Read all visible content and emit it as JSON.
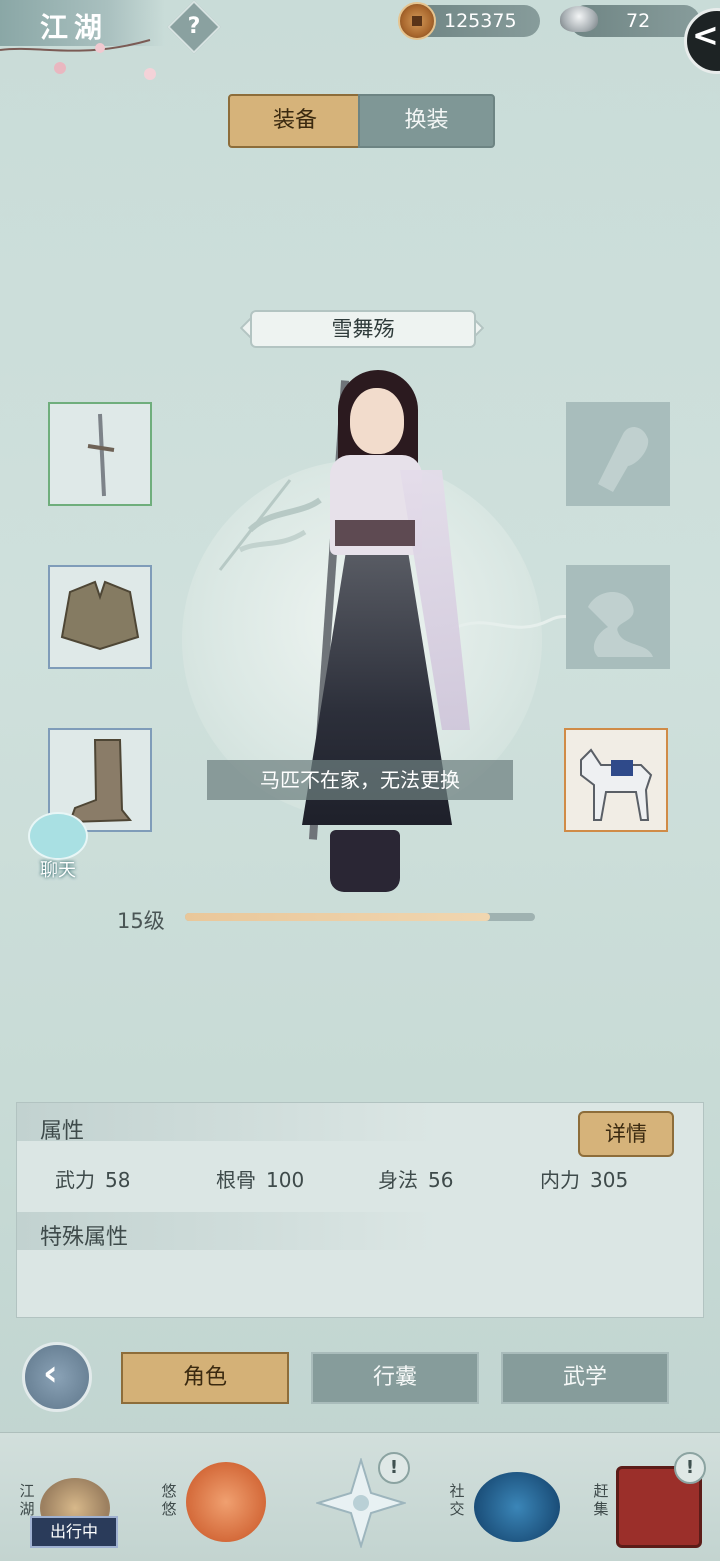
{
  "topbar": {
    "title": "江湖",
    "help_label": "?",
    "copper": "125375",
    "silver": "72",
    "back_label": "<"
  },
  "equip_tabs": {
    "active": "装备",
    "other": "换装"
  },
  "character": {
    "name": "雪舞殇"
  },
  "notice": "马匹不在家，无法更换",
  "chat": {
    "label": "聊天"
  },
  "level": {
    "label": "15级",
    "progress": 0.87
  },
  "attributes": {
    "title": "属性",
    "detail_button": "详情",
    "stats": [
      {
        "name": "武力",
        "value": "58"
      },
      {
        "name": "根骨",
        "value": "100"
      },
      {
        "name": "身法",
        "value": "56"
      },
      {
        "name": "内力",
        "value": "305"
      }
    ],
    "special_title": "特殊属性"
  },
  "bottom_tabs": {
    "role": "角色",
    "bag": "行囊",
    "martial": "武学"
  },
  "nav": {
    "jianghu": "江湖",
    "outing": "出行中",
    "youyou": "悠悠",
    "shejiao": "社交",
    "ganji": "赶集",
    "badge": "!"
  },
  "colors": {
    "accent_gold": "#d6b37a",
    "panel_bg": "#dbe6e4",
    "level_fill": "#e9c79a"
  }
}
